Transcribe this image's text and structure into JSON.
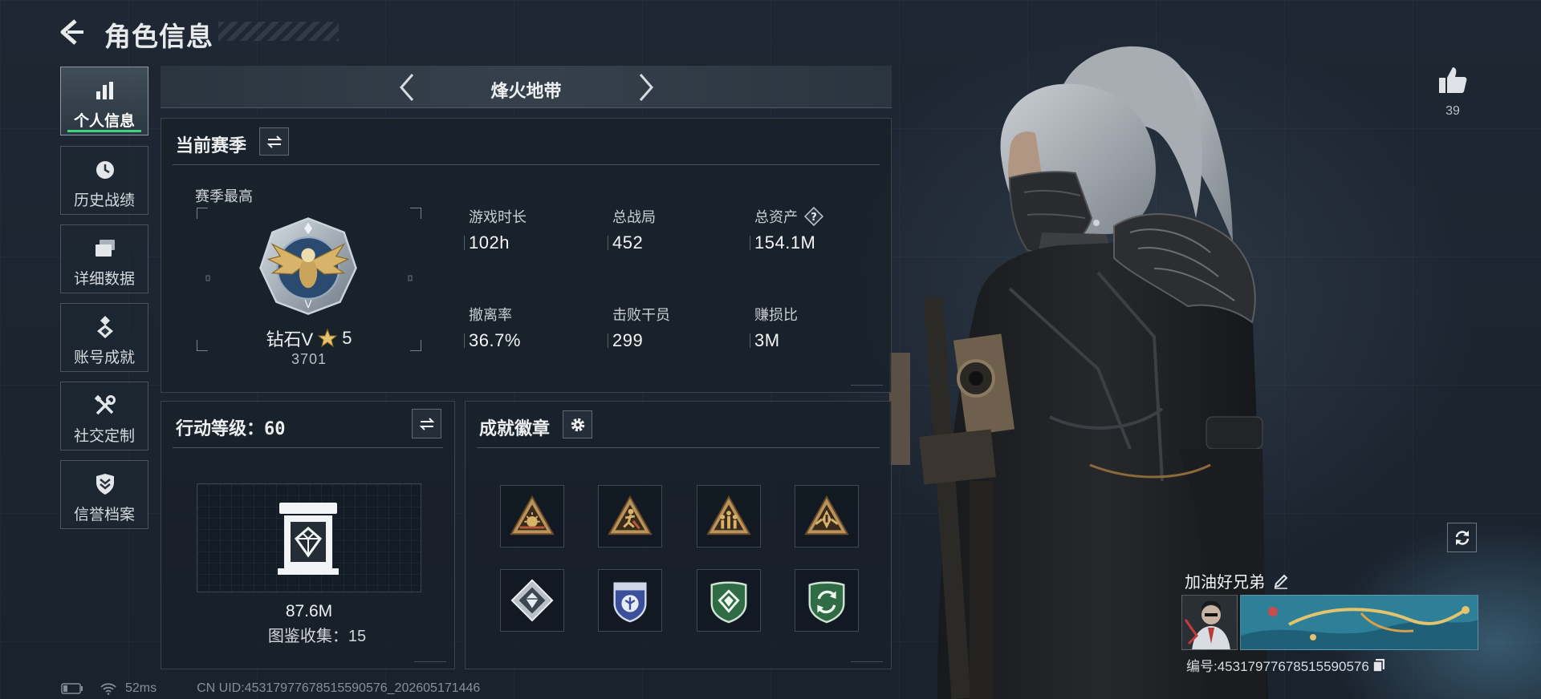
{
  "header": {
    "title": "角色信息",
    "back_icon": "back-arrow-icon"
  },
  "sidebar": {
    "items": [
      {
        "label": "个人信息",
        "icon": "bar-chart-icon",
        "active": true
      },
      {
        "label": "历史战绩",
        "icon": "clock-icon"
      },
      {
        "label": "详细数据",
        "icon": "stacked-cards-icon"
      },
      {
        "label": "账号成就",
        "icon": "medal-icon"
      },
      {
        "label": "社交定制",
        "icon": "tools-icon"
      },
      {
        "label": "信誉档案",
        "icon": "shield-chevron-icon"
      }
    ]
  },
  "mode": {
    "label": "烽火地带",
    "prev_icon": "chevron-left-icon",
    "next_icon": "chevron-right-icon"
  },
  "season": {
    "title": "当前赛季",
    "switch_icon": "swap-arrows-icon",
    "best_label": "赛季最高",
    "rank": {
      "tier": "钻石V",
      "stars": "5",
      "score": "3701",
      "icon": "diamond-eagle-rank-icon",
      "star_icon": "star-icon"
    },
    "stats": [
      {
        "label": "游戏时长",
        "value": "102h"
      },
      {
        "label": "总战局",
        "value": "452"
      },
      {
        "label": "总资产",
        "value": "154.1M",
        "help_icon": "question-icon"
      },
      {
        "label": "撤离率",
        "value": "36.7%"
      },
      {
        "label": "击败干员",
        "value": "299"
      },
      {
        "label": "赚损比",
        "value": "3M"
      }
    ]
  },
  "action_level": {
    "label": "行动等级：",
    "level": "60",
    "switch_icon": "swap-arrows-icon",
    "collection_icon": "collection-case-icon",
    "collection_value": "87.6M",
    "collection_label": "图鉴收集：",
    "collection_count": "15"
  },
  "achievements": {
    "title": "成就徽章",
    "settings_icon": "gear-icon",
    "badges": [
      "triangle-sun-badge-icon",
      "triangle-runner-badge-icon",
      "triangle-squad-badge-icon",
      "triangle-emblem-badge-icon",
      "diamond-gem-badge-icon",
      "blue-shield-badge-icon",
      "green-shield-badge-icon",
      "green-cycle-shield-badge-icon"
    ]
  },
  "profile": {
    "like_icon": "thumbs-up-icon",
    "likes": "39",
    "refresh_icon": "refresh-icon",
    "name": "加油好兄弟",
    "edit_icon": "pencil-icon",
    "id_text": "编号:45317977678515590576",
    "copy_icon": "copy-icon"
  },
  "status": {
    "battery_icon": "battery-icon",
    "wifi_icon": "wifi-icon",
    "ping": "52ms",
    "uid": "CN UID:45317977678515590576_202605171446"
  },
  "colors": {
    "background": "#1b2330",
    "accent_green": "#3ed47f",
    "text": "#e4e7ea",
    "gold": "#d8b46a"
  }
}
